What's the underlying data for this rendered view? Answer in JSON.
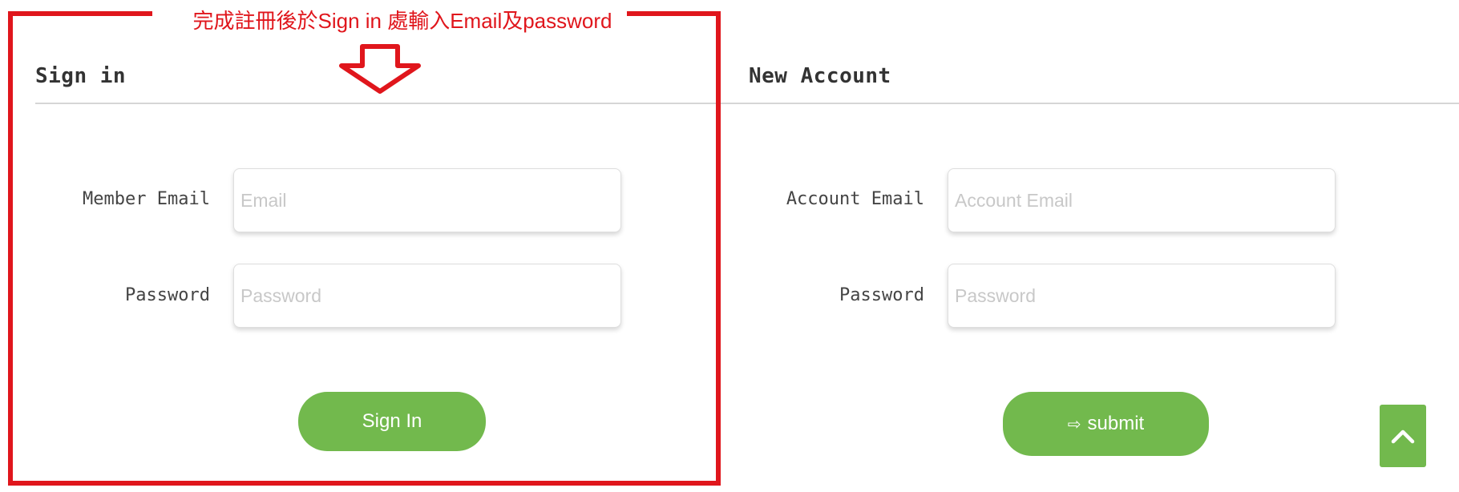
{
  "annotation": {
    "note": "完成註冊後於Sign in 處輸入Email及password",
    "color": "#e0161c"
  },
  "sign_in": {
    "title": "Sign in",
    "email_label": "Member Email",
    "email_value": "",
    "email_placeholder": "Email",
    "password_label": "Password",
    "password_value": "",
    "password_placeholder": "Password",
    "button_label": "Sign In"
  },
  "new_account": {
    "title": "New Account",
    "email_label": "Account Email",
    "email_value": "",
    "email_placeholder": "Account Email",
    "password_label": "Password",
    "password_value": "",
    "password_placeholder": "Password",
    "button_icon": "arrow-right-outline-icon",
    "button_label": "submit"
  },
  "scroll_top": {
    "icon": "chevron-up-icon"
  },
  "colors": {
    "accent_green": "#72b94d",
    "annotation_red": "#e0161c",
    "divider": "#d6d6d6",
    "heading_text": "#333333"
  }
}
